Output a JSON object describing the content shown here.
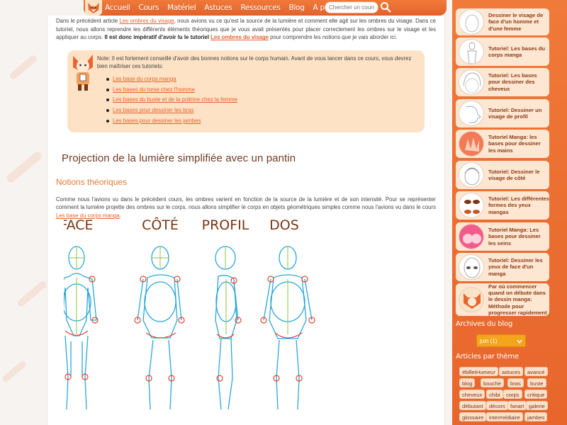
{
  "nav": {
    "items": [
      "Accueil",
      "Cours",
      "Matériel",
      "Astuces",
      "Ressources",
      "Blog",
      "A propos"
    ],
    "search_placeholder": "Chercher un cours..."
  },
  "intro": {
    "text1": "Dans le précédent article ",
    "link1": "Les ombres du visage",
    "text2": ", nous avions vu ce qu'est la source de la lumière et comment elle agit sur les ombres du visage. Dans ce tutoriel, nous allons reprendre les différents éléments théoriques que je vous avait présentés pour placer correctement les ombres sur le visage et les appliquer au corps. ",
    "bold": "Il est donc impératif d'avoir lu le tutoriel ",
    "link2": "Les ombres du visage",
    "text3": " pour comprendre les notions que je vais aborder ici."
  },
  "note": {
    "text": "Note: Il est fortement conseillé d'avoir des bonnes notions sur le corps humain. Avant de vous lancer dans ce cours, vous devrez bien maîtriser ces tutoriels:",
    "links": [
      "Les base du corps manga",
      "Les bases du torse chez l'homme",
      "Les bases du buste et de la poitrine chez la femme",
      "Les bases pour dessiner les bras",
      "Les bases pour dessiner les jambes"
    ]
  },
  "section_title": "Projection de la lumière simplifiée avec un pantin",
  "subsection_title": "Notions théoriques",
  "para": {
    "text": "Comme nous l'avions vu dans le précédent cours, les ombres varient en fonction de la source de la lumière et de son intensité. Pour se représenter comment la lumière projette des ombres sur le corps, nous allons simplifier le corps en objets géométriques simples comme nous l'avions vu dans le cours ",
    "link": "Les base du corps manga",
    "end": "."
  },
  "figure_labels": [
    "FACE",
    "CÔTÉ",
    "PROFIL",
    "DOS"
  ],
  "sidebar": {
    "items": [
      "Dessiner le visage de face d'un homme et d'une femme",
      "Tutoriel: Les bases du corps manga",
      "Tutoriel: Les bases pour dessiner des cheveux",
      "Tutoriel: Dessiner un visage de profil",
      "Tutoriel Manga: les bases pour dessiner les mains",
      "Tutoriel: Dessiner le visage de côté",
      "Tutoriel: Les différentes formes des yeux mangas",
      "Tutoriel Manga: Les bases pour dessiner les seins",
      "Tutoriel: Dessiner les yeux de face d'un manga",
      "Par où commencer quand on débute dans le dessin manga: Méthode pour progresser rapidement"
    ],
    "archives_title": "Archives du blog",
    "archive_selected": "juin (1)",
    "tags_title": "Articles par thème",
    "tags": [
      "#billetHumeur",
      "astuces",
      "avancé",
      "blog",
      "bouche",
      "bras",
      "buste",
      "cheveux",
      "chibi",
      "corps",
      "critique",
      "débutant",
      "décors",
      "fanart",
      "galerie",
      "glossaire",
      "intermédiaire",
      "jambes"
    ]
  },
  "colors": {
    "accent": "#e2622a",
    "heading": "#6e3c22",
    "note_bg": "#fde2c5",
    "sidebar": "#ea6c30"
  }
}
